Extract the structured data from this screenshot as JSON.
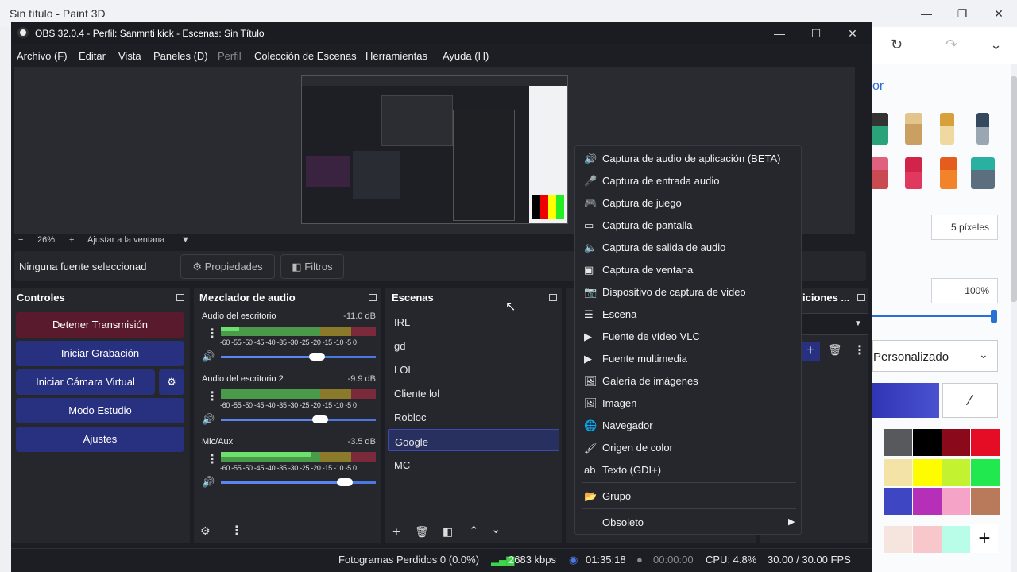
{
  "paint3d": {
    "title": "Sin título - Paint 3D",
    "panel_title": "or",
    "thickness": "5 píxeles",
    "opacity": "100%",
    "finish": "Personalizado",
    "colors": {
      "row1": [
        "#58595d",
        "#000000",
        "#8a0a1c",
        "#e50c25"
      ],
      "row2": [
        "#f3e3a7",
        "#fffc00",
        "#c3f231",
        "#22e84f"
      ],
      "row3": [
        "#3e46c4",
        "#b62fb8",
        "#f5a3c7",
        "#b87a5b"
      ],
      "row4": [
        "#f6e4de",
        "#f8c7cc",
        "#b9fde9"
      ]
    },
    "add_label": "+"
  },
  "obs": {
    "title": "OBS 32.0.4 - Perfil: Sanmnti kick - Escenas: Sin Título",
    "menu": [
      "Archivo (F)",
      "Editar",
      "Vista",
      "Paneles (D)",
      "Perfil",
      "Colección de Escenas",
      "Herramientas",
      "Ayuda (H)"
    ],
    "zoom": {
      "minus": "−",
      "level": "26%",
      "plus": "+",
      "fit": "Ajustar a la ventana"
    },
    "source_bar": {
      "none": "Ninguna fuente seleccionada",
      "properties": "Propiedades",
      "filters": "Filtros"
    },
    "controls": {
      "title": "Controles",
      "buttons": [
        "Detener Transmisión",
        "Iniciar Grabación",
        "Iniciar Cámara Virtual",
        "Modo Estudio",
        "Ajustes"
      ]
    },
    "mixer": {
      "title": "Mezclador de audio",
      "channels": [
        {
          "name": "Audio del escritorio",
          "db": "-11.0 dB",
          "level": 0.12,
          "volume": 0.62
        },
        {
          "name": "Audio del escritorio 2",
          "db": "-9.9 dB",
          "level": 0.0,
          "volume": 0.64
        },
        {
          "name": "Mic/Aux",
          "db": "-3.5 dB",
          "level": 0.58,
          "volume": 0.8
        }
      ],
      "ticks": "-60 -55 -50 -45 -40 -35 -30 -25 -20 -15 -10 -5 0"
    },
    "scenes": {
      "title": "Escenas",
      "items": [
        "IRL",
        "gd",
        "LOL",
        "Cliente lol",
        "Robloc",
        "Google",
        "MC"
      ],
      "selected": "Google"
    },
    "transitions_title": "iciones ...",
    "context_menu": [
      {
        "icon": "speaker-app-icon",
        "glyph": "🔊",
        "label": "Captura de audio de aplicación (BETA)"
      },
      {
        "icon": "microphone-icon",
        "glyph": "🎤",
        "label": "Captura de entrada audio"
      },
      {
        "icon": "gamepad-icon",
        "glyph": "🎮",
        "label": "Captura de juego"
      },
      {
        "icon": "monitor-icon",
        "glyph": "▭",
        "label": "Captura de pantalla"
      },
      {
        "icon": "speaker-icon",
        "glyph": "🔈",
        "label": "Captura de salida de audio"
      },
      {
        "icon": "window-icon",
        "glyph": "▣",
        "label": "Captura de ventana"
      },
      {
        "icon": "camera-icon",
        "glyph": "📷",
        "label": "Dispositivo de captura de video"
      },
      {
        "icon": "list-icon",
        "glyph": "☰",
        "label": "Escena"
      },
      {
        "icon": "play-icon",
        "glyph": "▶",
        "label": "Fuente de vídeo VLC"
      },
      {
        "icon": "play-media-icon",
        "glyph": "▶",
        "label": "Fuente multimedia"
      },
      {
        "icon": "gallery-icon",
        "glyph": "🖼",
        "label": "Galería de imágenes"
      },
      {
        "icon": "image-icon",
        "glyph": "🖼",
        "label": "Imagen"
      },
      {
        "icon": "globe-icon",
        "glyph": "🌐",
        "label": "Navegador"
      },
      {
        "icon": "brush-icon",
        "glyph": "🖌",
        "label": "Origen de color"
      },
      {
        "icon": "text-icon",
        "glyph": "ab",
        "label": "Texto (GDI+)"
      },
      {
        "icon": "folder-icon",
        "glyph": "📂",
        "label": "Grupo"
      },
      {
        "icon": "",
        "glyph": "",
        "label": "Obsoleto"
      }
    ],
    "status": {
      "dropped": "Fotogramas Perdidos 0 (0.0%)",
      "bitrate": "2683 kbps",
      "stream_time": "01:35:18",
      "rec_time": "00:00:00",
      "cpu": "CPU: 4.8%",
      "fps": "30.00 / 30.00 FPS"
    }
  }
}
